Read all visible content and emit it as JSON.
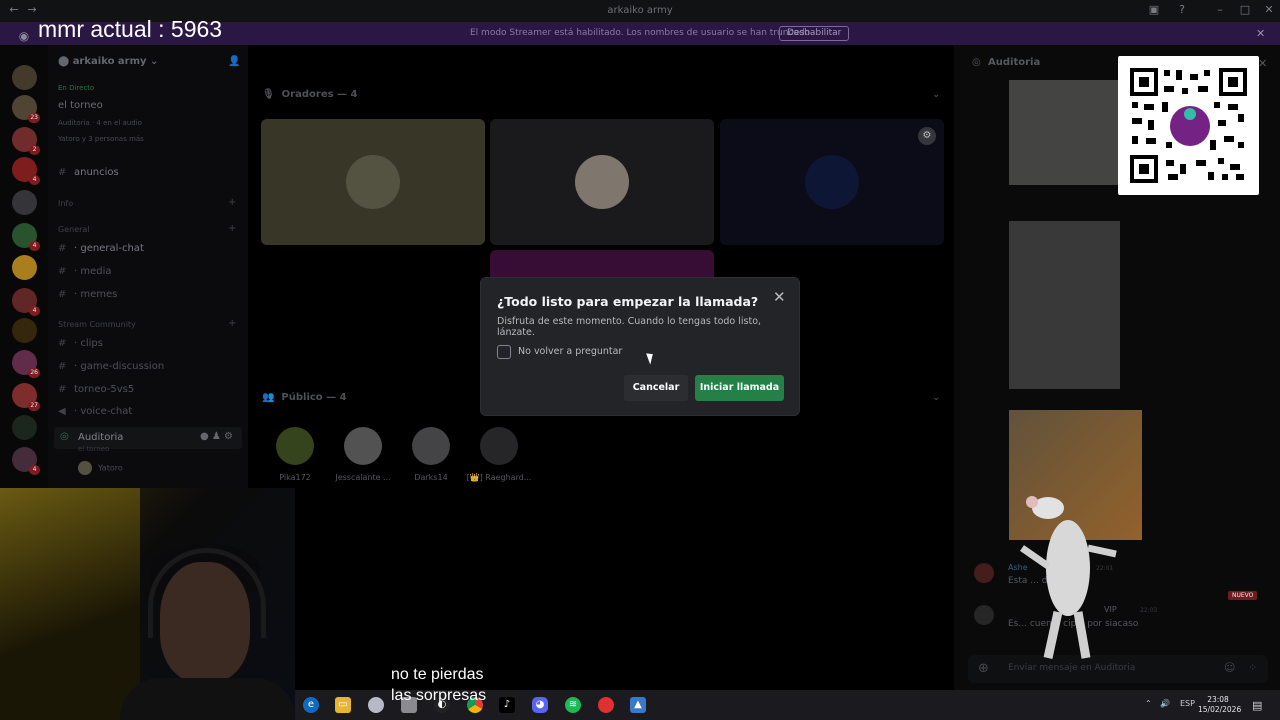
{
  "overlay": {
    "mmr": "mmr actual : 5963",
    "subtitle_line1": "no te pierdas",
    "subtitle_line2": "las sorpresas"
  },
  "window": {
    "title": "arkaiko army"
  },
  "banner": {
    "message": "El modo Streamer está habilitado. Los nombres de usuario se han truncado.",
    "disable_label": "Deshabilitar"
  },
  "server_rail": {
    "badges": [
      "23",
      "2",
      "4",
      "4",
      "4",
      "26",
      "27",
      "4"
    ]
  },
  "sidebar": {
    "server_name": "arkaiko army",
    "event": {
      "live": "En Directo",
      "title": "el torneo",
      "meta": "Auditoria · 4 en el audio",
      "meta2": "Yatoro y 3 personas más"
    },
    "channels": [
      {
        "name": "anuncios",
        "bright": true
      },
      {
        "name": "· general-chat",
        "bright": true
      },
      {
        "name": "· media"
      },
      {
        "name": "· memes"
      },
      {
        "name": "· clips"
      },
      {
        "name": "· game-discussion"
      },
      {
        "name": "torneo-5vs5"
      },
      {
        "name": "· voice-chat"
      }
    ],
    "categories": [
      "Info",
      "General",
      "Stream Community"
    ],
    "voice": {
      "name": "Auditoria",
      "sub": "el torneo",
      "user": "Yatoro"
    }
  },
  "main": {
    "speakers_header": "Oradores — 4",
    "public_header": "Público — 4",
    "public_users": [
      "Pika172",
      "Jesscalante ...",
      "Darks14",
      "[👑] Raeghard..."
    ]
  },
  "chat": {
    "header": "Auditoria",
    "messages": [
      {
        "name": "Ashe",
        "time": "22:01",
        "text": "Esta ... dc"
      },
      {
        "name": "VIP",
        "time": "22:03",
        "text": "Es... cuen... cipal por siacaso"
      }
    ],
    "new_badge": "NUEVO",
    "composer_placeholder": "Enviar mensaje en Auditoria"
  },
  "modal": {
    "title": "¿Todo listo para empezar la llamada?",
    "description": "Disfruta de este momento. Cuando lo tengas todo listo, lánzate.",
    "checkbox_label": "No volver a preguntar",
    "cancel_label": "Cancelar",
    "start_label": "Iniciar llamada"
  },
  "taskbar": {
    "lang": "ESP",
    "time": "23:08",
    "date": "15/02/2026"
  },
  "colors": {
    "accent_green": "#248046",
    "banner_purple": "#2b1744",
    "modal_bg": "#232428"
  }
}
